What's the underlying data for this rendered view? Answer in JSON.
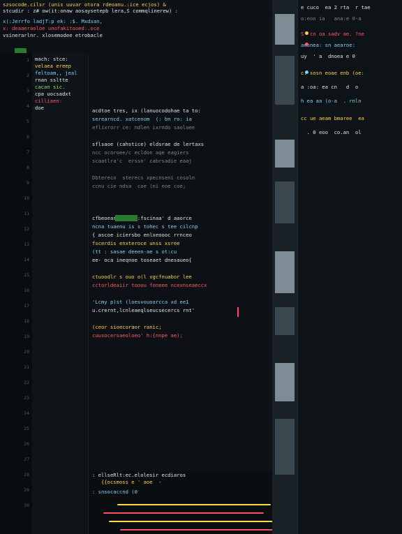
{
  "topbar": {
    "lines": [
      "szsocode.cilsr (unis uuvar otora rdeoanu.:ice ecjos) &",
      "stcudir : z# ow(it:onaw aosaysetepb lera,S commqlinerew) :"
    ]
  },
  "header": {
    "lines": [
      "x(:Jerrfo ladjT:p ek: :$. Mxdxan,",
      "x: deaaeraoloe unofakitooed:.oce",
      "vsinerarlnr. xlosemodee etrobacle"
    ]
  },
  "gutter": {
    "numbers": [
      "1",
      "2",
      "3",
      "4",
      "5",
      "6",
      "7",
      "8",
      "9",
      "10",
      "11",
      "12",
      "13",
      "14",
      "15",
      "16",
      "17",
      "18",
      "19",
      "20",
      "21",
      "22",
      "23",
      "24",
      "25",
      "26",
      "27",
      "28",
      "29",
      "30"
    ]
  },
  "tree": {
    "items": [
      "mach: stce:",
      "velaea ereep",
      "feltoam,, jeal",
      "rnan ssltte",
      "cacan sic.",
      "cpa uocsadxt",
      "cilliaen:",
      "doe"
    ]
  },
  "editor": {
    "lines": [
      "acdtoe tres, ix (lanuocodohae ta to:",
      "serearncd. xatcenom  (: bn ro: ia",
      "eflixrorr ce: ndlen ixrndo saolaee",
      "sflsaoe (cahstice) eldsrae de lertaxs",
      "ncc ocoroee/c ecldon aqe eagiers",
      "scaatlra'c  erssn' cabrsadie eaaj",
      "Dbterecn  sterecs xpecnseni cosoln",
      "ccnu cie ndsa  coe (ni noe coe;",
      "cfbeoeas stfn: :fscinaa' d aaorce",
      "ncna tuaenu is s tohec s tee cilcnp",
      "{ ascoe iciersbo enlxeoooc rrnceo",
      "fscerdis enxteroce unss xsree",
      "(tt : sasae deeen-ae s ot:cu",
      "ee- oca ineqnoe toseaet dnesaueo{",
      "ctuoodlr s ouo o(l vgcfnuabor lee",
      "cctorldeaiir tooou foneee ncexnseaeccx",
      "'Lcmy p)st (loesvouoarcca xd ee1",
      "u.crernt,lcnleaeqlseucsecercs rnt'",
      "(ceor sioecoraor ranic;",
      "cuusocersaeoloeo' h:{nnpe ae);"
    ]
  },
  "bottom": {
    "lines": [
      ": ellseRlt:ec.elolesir ecdiaros",
      "   {{ocsmoss e ' aoe  -   ",
      ": snsocaccnd (0"
    ]
  },
  "right": {
    "lines": [
      "e cuco  ea 2 rta  r tae",
      "o:eon ia   ana:e 0-a",
      "S  cn oa sadv ae. ?ne",
      "aeonea: sn aearoe:",
      "uy  ' a  dnoea e 0",
      "c: sosn eoae enb (oe:",
      "a :oa: ea cn   d  o",
      "h ea aa (o-a  . rnln",
      "cc ue aeam bmaree  ea",
      "  . 0 eoo  co.an  ol"
    ]
  }
}
